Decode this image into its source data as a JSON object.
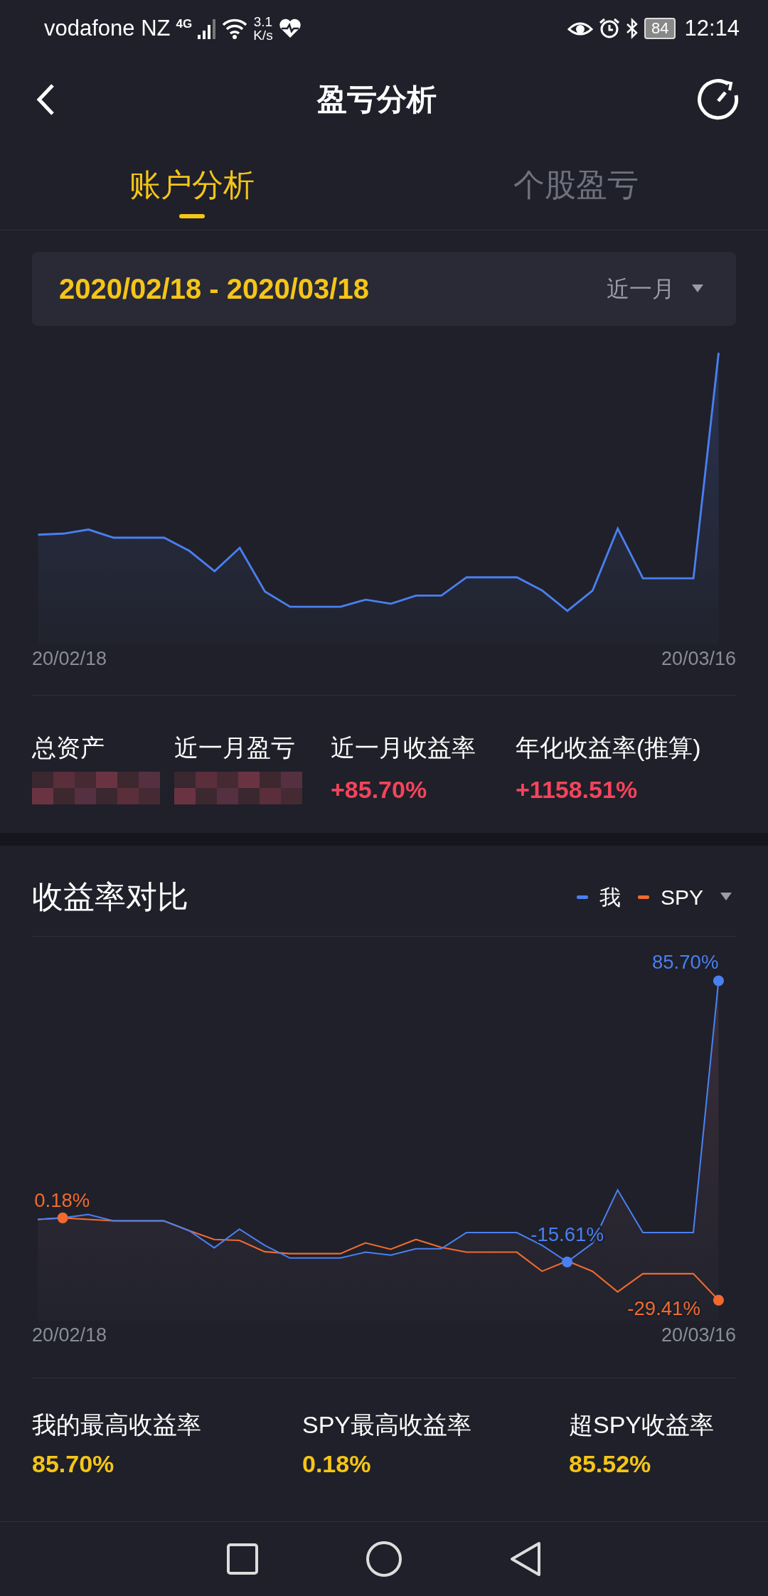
{
  "status_bar": {
    "carrier": "vodafone NZ",
    "network": "4G",
    "speed": "3.1",
    "speed_unit": "K/s",
    "battery": "84",
    "time": "12:14"
  },
  "header": {
    "title": "盈亏分析"
  },
  "tabs": [
    {
      "label": "账户分析",
      "selected": true
    },
    {
      "label": "个股盈亏",
      "selected": false
    }
  ],
  "date_range": {
    "text": "2020/02/18 - 2020/03/18",
    "period": "近一月"
  },
  "asset_chart": {
    "x_start": "20/02/18",
    "x_end": "20/03/16"
  },
  "summary": [
    {
      "label": "总资产",
      "kind": "masked"
    },
    {
      "label": "近一月盈亏",
      "kind": "masked"
    },
    {
      "label": "近一月收益率",
      "kind": "value",
      "value": "+85.70%"
    },
    {
      "label": "年化收益率(推算)",
      "kind": "value",
      "value": "+1158.51%"
    }
  ],
  "comparison": {
    "title": "收益率对比",
    "legend": [
      {
        "label": "我",
        "color": "#4a7ff0"
      },
      {
        "label": "SPY",
        "color": "#f06a30"
      }
    ],
    "point_labels": [
      {
        "text": "85.70%",
        "color": "#4a7ff0"
      },
      {
        "text": "0.18%",
        "color": "#f06a30"
      },
      {
        "text": "-15.61%",
        "color": "#4a7ff0"
      },
      {
        "text": "-29.41%",
        "color": "#f06a30"
      }
    ],
    "x_start": "20/02/18",
    "x_end": "20/03/16"
  },
  "stats": [
    {
      "label": "我的最高收益率",
      "value": "85.70%"
    },
    {
      "label": "SPY最高收益率",
      "value": "0.18%"
    },
    {
      "label": "超SPY收益率",
      "value": "85.52%"
    }
  ]
}
